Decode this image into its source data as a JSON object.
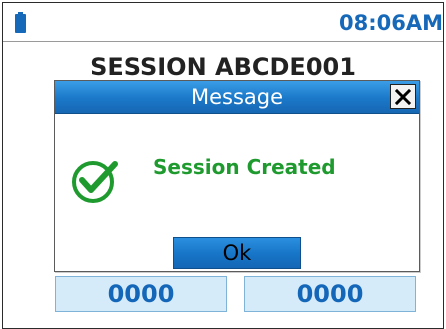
{
  "status_bar": {
    "battery_icon": "battery-icon",
    "time": "08:06AM",
    "time_color": "#1668b8"
  },
  "session": {
    "title": "SESSION ABCDE001"
  },
  "counters": {
    "left": "0000",
    "right": "0000"
  },
  "dialog": {
    "title": "Message",
    "close_icon": "close-icon",
    "status_icon": "check-circle-icon",
    "message": "Session Created",
    "ok_label": "Ok",
    "accent_color": "#1b78c9",
    "success_color": "#1e9a2e"
  }
}
